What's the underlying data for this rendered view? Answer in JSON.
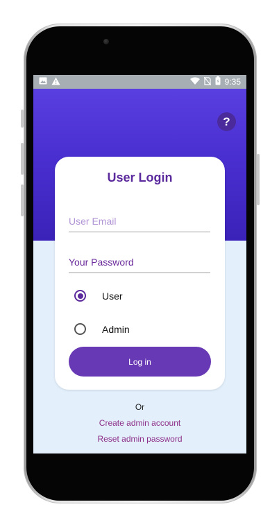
{
  "status_bar": {
    "time": "9:35",
    "left_icons": [
      "image-icon",
      "warning-icon"
    ],
    "right_icons": [
      "wifi-icon",
      "no-sim-icon",
      "battery-icon"
    ]
  },
  "header": {
    "help_label": "?"
  },
  "login_card": {
    "title": "User Login",
    "email_placeholder": "User Email",
    "password_placeholder": "Your Password",
    "role_options": [
      {
        "label": "User",
        "selected": true
      },
      {
        "label": "Admin",
        "selected": false
      }
    ],
    "login_label": "Log in"
  },
  "footer": {
    "or_text": "Or",
    "create_admin_label": "Create admin account",
    "reset_admin_label": "Reset admin password"
  },
  "colors": {
    "hero_top": "#5a3fe0",
    "hero_bottom": "#3a22b8",
    "accent": "#5b2a9d",
    "button": "#6839b4",
    "link": "#8d2e88",
    "background": "#e3f0fc"
  }
}
